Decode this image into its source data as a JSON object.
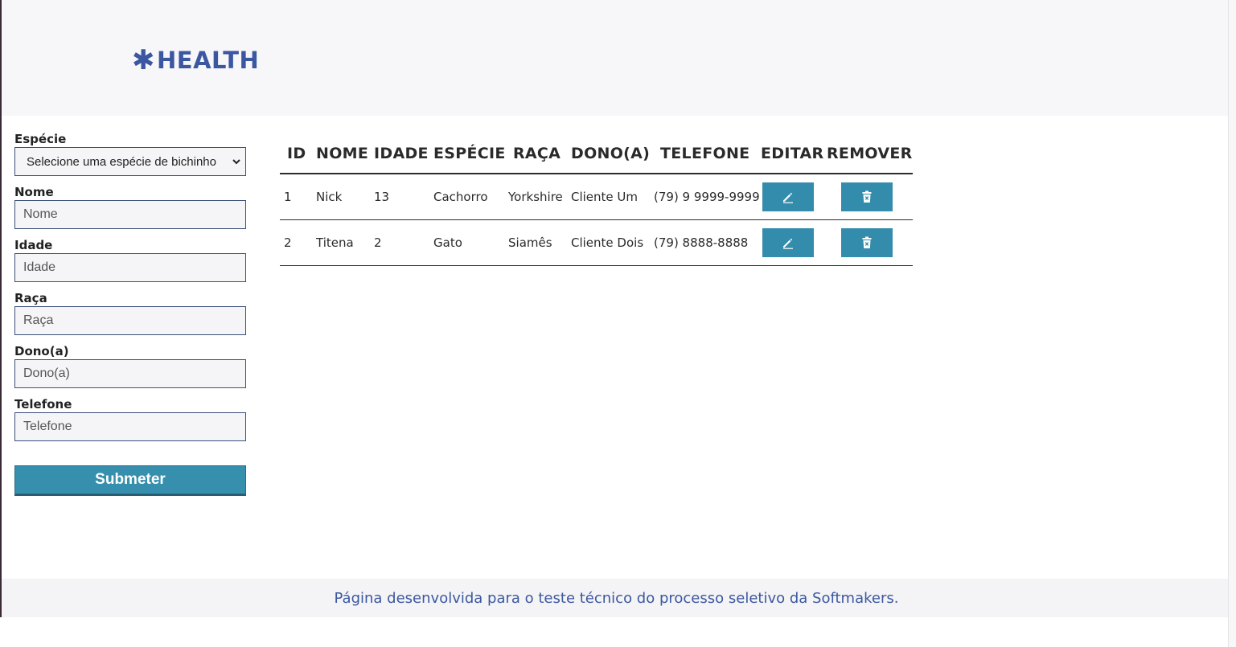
{
  "header": {
    "logo_symbol": "✱",
    "logo_text": "HEALTH",
    "brand_color": "#3c57a1"
  },
  "form": {
    "especie_label": "Espécie",
    "especie_selected": "Selecione uma espécie de bichinho",
    "nome_label": "Nome",
    "nome_placeholder": "Nome",
    "idade_label": "Idade",
    "idade_placeholder": "Idade",
    "raca_label": "Raça",
    "raca_placeholder": "Raça",
    "dono_label": "Dono(a)",
    "dono_placeholder": "Dono(a)",
    "telefone_label": "Telefone",
    "telefone_placeholder": "Telefone",
    "submit_label": "Submeter"
  },
  "table": {
    "headers": [
      "ID",
      "NOME",
      "IDADE",
      "ESPÉCIE",
      "RAÇA",
      "DONO(A)",
      "TELEFONE",
      "EDITAR",
      "REMOVER"
    ],
    "rows": [
      {
        "id": "1",
        "nome": "Nick",
        "idade": "13",
        "especie": "Cachorro",
        "raca": "Yorkshire",
        "dono": "Cliente Um",
        "telefone": "(79) 9 9999-9999",
        "edit_icon": "pencil-icon",
        "remove_icon": "trash-icon"
      },
      {
        "id": "2",
        "nome": "Titena",
        "idade": "2",
        "especie": "Gato",
        "raca": "Siamês",
        "dono": "Cliente Dois",
        "telefone": "(79) 8888-8888",
        "edit_icon": "pencil-icon",
        "remove_icon": "trash-icon"
      }
    ],
    "button_color": "#348cac"
  },
  "footer": {
    "text": "Página desenvolvida para o teste técnico do processo seletivo da Softmakers."
  }
}
